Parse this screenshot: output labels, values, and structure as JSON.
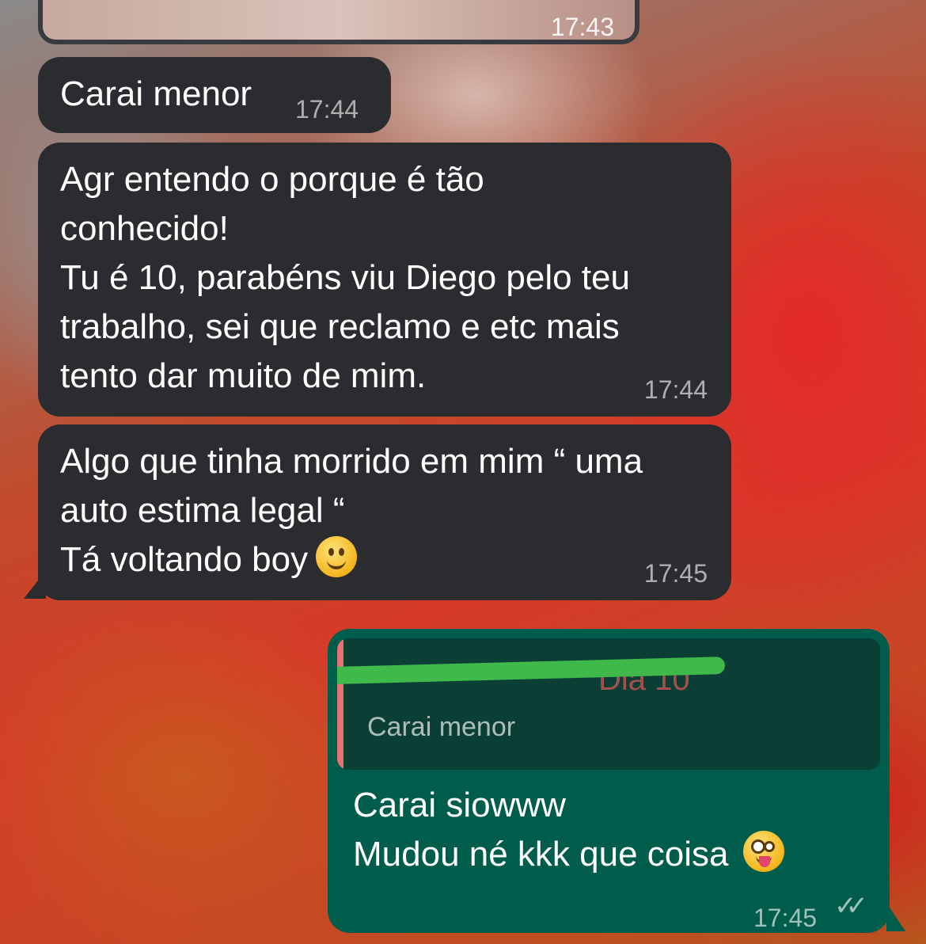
{
  "messages": [
    {
      "id": "m0",
      "time": "17:43"
    },
    {
      "id": "m1",
      "lines": [
        "Carai menor"
      ],
      "time": "17:44"
    },
    {
      "id": "m2",
      "lines": [
        "Agr entendo o porque é tão",
        "conhecido!",
        "Tu é 10, parabéns viu Diego pelo teu",
        "trabalho, sei que reclamo e etc mais",
        "tento dar muito de mim."
      ],
      "time": "17:44"
    },
    {
      "id": "m3",
      "lines": [
        "Algo que tinha morrido em mim “ uma",
        "auto estima legal “",
        "Tá voltando boy"
      ],
      "emoji": "slightly-smiling-face",
      "time": "17:45"
    },
    {
      "id": "m4",
      "quoted": {
        "author": "Dia 10",
        "text": "Carai menor"
      },
      "lines": [
        "Carai siowww",
        "Mudou né kkk que coisa"
      ],
      "emoji": "zany-face",
      "time": "17:45",
      "status": "read"
    }
  ],
  "colors": {
    "incoming_bubble": "#2b2c2f",
    "outgoing_bubble": "#005c4b",
    "quote_bar": "#e57373"
  }
}
